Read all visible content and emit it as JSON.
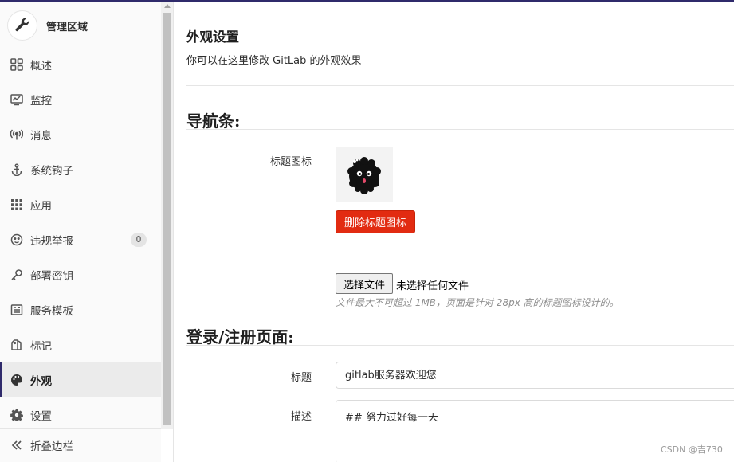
{
  "sidebar": {
    "context_title": "管理区域",
    "items": [
      {
        "label": "概述",
        "icon": "grid-icon"
      },
      {
        "label": "监控",
        "icon": "monitor-icon"
      },
      {
        "label": "消息",
        "icon": "broadcast-icon"
      },
      {
        "label": "系统钩子",
        "icon": "anchor-icon"
      },
      {
        "label": "应用",
        "icon": "apps-icon"
      },
      {
        "label": "违规举报",
        "icon": "smiley-icon",
        "badge": "0"
      },
      {
        "label": "部署密钥",
        "icon": "key-icon"
      },
      {
        "label": "服务模板",
        "icon": "template-icon"
      },
      {
        "label": "标记",
        "icon": "labels-icon"
      },
      {
        "label": "外观",
        "icon": "palette-icon",
        "active": true
      },
      {
        "label": "设置",
        "icon": "gear-icon"
      }
    ],
    "collapse_label": "折叠边栏"
  },
  "page": {
    "title": "外观设置",
    "description": "你可以在这里修改 GitLab 的外观效果"
  },
  "navbar_section": {
    "heading": "导航条:",
    "logo_label": "标题图标",
    "remove_logo_button": "删除标题图标",
    "file_button": "选择文件",
    "file_status": "未选择任何文件",
    "help_text": "文件最大不可超过 1MB，页面是针对 28px 高的标题图标设计的。"
  },
  "signin_section": {
    "heading": "登录/注册页面:",
    "title_label": "标题",
    "title_value": "gitlab服务器欢迎您",
    "description_label": "描述",
    "description_value": "##  努力过好每一天"
  },
  "watermark": "CSDN @吉730",
  "colors": {
    "accent": "#2f2a6b",
    "danger": "#e22b11",
    "sidebar_bg": "#fafafa"
  }
}
